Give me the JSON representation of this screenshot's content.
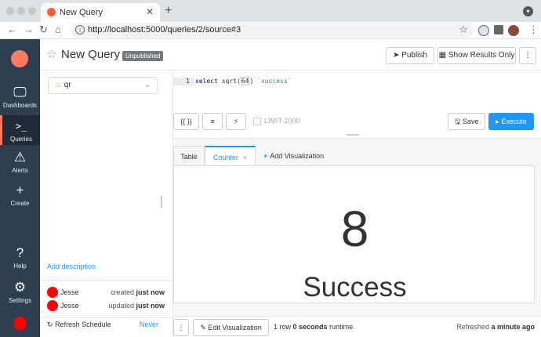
{
  "browser": {
    "tab_title": "New Query",
    "url": "http://localhost:5000/queries/2/source#3"
  },
  "nav": {
    "dashboards": "Dashboards",
    "queries": "Queries",
    "alerts": "Alerts",
    "create": "Create",
    "help": "Help",
    "settings": "Settings"
  },
  "header": {
    "title": "New Query",
    "badge": "Unpublished",
    "publish": "Publish",
    "show_results": "Show Results Only",
    "more": "⋮"
  },
  "datasource": {
    "value": "qr"
  },
  "left": {
    "add_description": "Add description",
    "history": [
      {
        "user": "Jesse",
        "action": "created",
        "when": "just now"
      },
      {
        "user": "Jesse",
        "action": "updated",
        "when": "just now"
      }
    ],
    "refresh_label": "Refresh Schedule",
    "refresh_value": "Never"
  },
  "editor": {
    "line_number": "1",
    "query_keyword": "select",
    "query_func": "sqrt(",
    "query_arg": "64",
    "query_close": ")",
    "query_alias": "`success`"
  },
  "controls": {
    "params": "{{ }}",
    "format": "≡",
    "autocomplete": "⚡",
    "limit": "LIMIT 1000",
    "save": "Save",
    "execute": "Execute"
  },
  "viz": {
    "tabs": [
      "Table",
      "Counter"
    ],
    "active_tab": "Counter",
    "add_visualization": "Add Visualization",
    "counter_value": "8",
    "counter_label": "Success"
  },
  "footer": {
    "edit_visualization": "Edit Visualization",
    "rows": "1 row",
    "runtime_strong": "0 seconds",
    "runtime_label": "runtime",
    "refreshed_label": "Refreshed",
    "refreshed_when": "a minute ago"
  },
  "colors": {
    "sidebar": "#2e3e4e",
    "accent": "#2196f3",
    "brand": "#ff7964"
  }
}
